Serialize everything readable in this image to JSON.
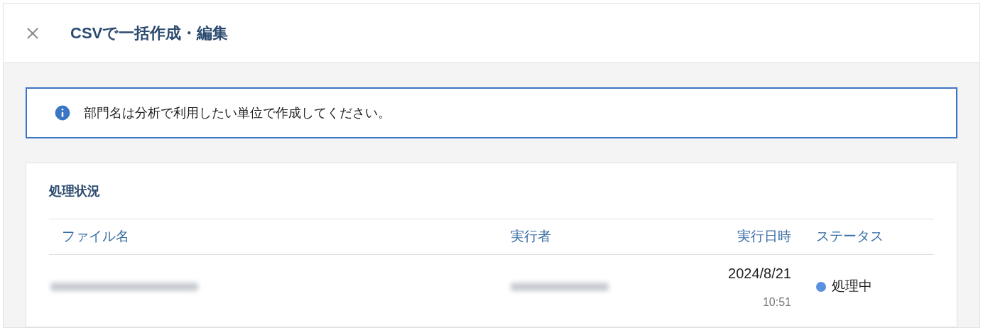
{
  "header": {
    "title": "CSVで一括作成・編集"
  },
  "notice": {
    "text": "部門名は分析で利用したい単位で作成してください。"
  },
  "card": {
    "title": "処理状況",
    "columns": [
      "ファイル名",
      "実行者",
      "実行日時",
      "ステータス"
    ],
    "rows": [
      {
        "date": "2024/8/21",
        "time": "10:51",
        "status": {
          "label": "処理中",
          "color": "#5b8fe0"
        }
      }
    ]
  }
}
